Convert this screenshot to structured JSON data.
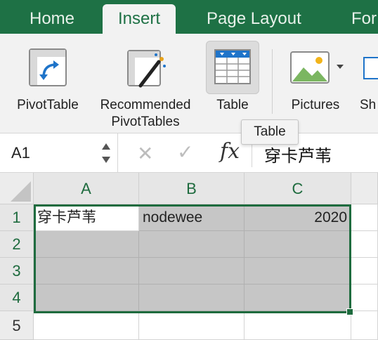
{
  "ribbon_tabs": [
    {
      "label": "Home"
    },
    {
      "label": "Insert"
    },
    {
      "label": "Page Layout"
    },
    {
      "label": "For"
    }
  ],
  "ribbon": {
    "pivot_table": "PivotTable",
    "recommended_line1": "Recommended",
    "recommended_line2": "PivotTables",
    "table": "Table",
    "pictures": "Pictures",
    "shapes_partial": "Sh",
    "tooltip": "Table"
  },
  "formula_bar": {
    "name_box": "A1",
    "fx": "fx",
    "content": "穿卡芦苇"
  },
  "grid": {
    "columns": [
      "A",
      "B",
      "C"
    ],
    "rows": [
      "1",
      "2",
      "3",
      "4",
      "5"
    ],
    "cells": {
      "a1": "穿卡芦苇",
      "b1": "nodewee",
      "c1": "2020"
    }
  },
  "colors": {
    "accent": "#1e7145",
    "selection_fill": "#c6c6c6"
  }
}
